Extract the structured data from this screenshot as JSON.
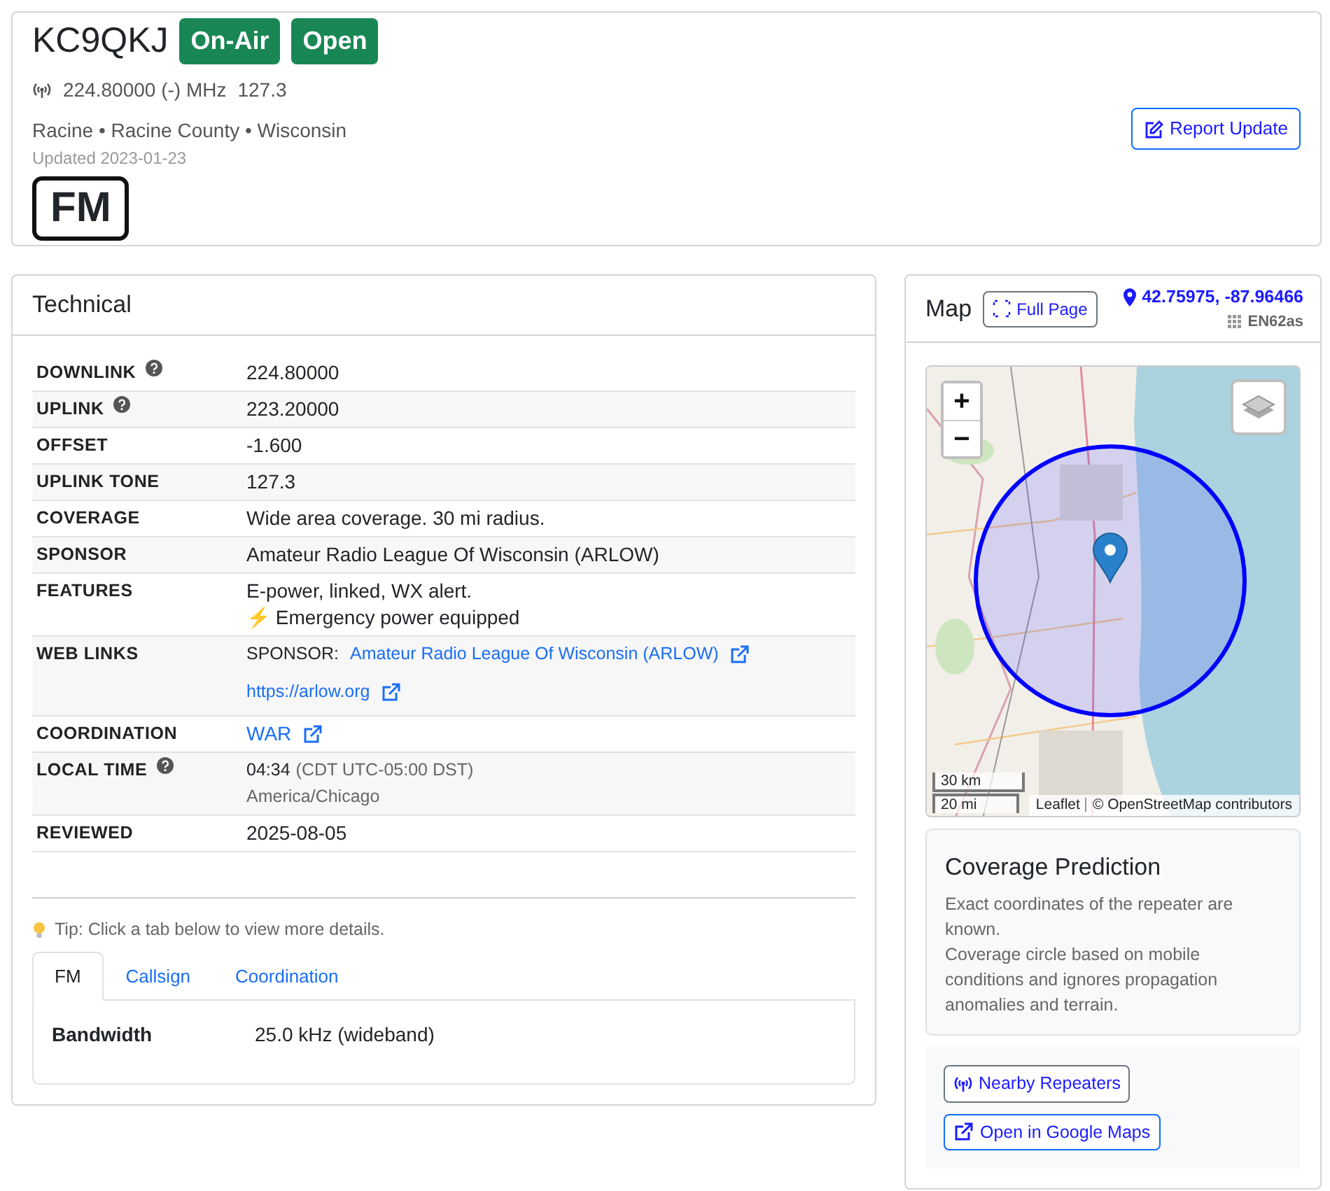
{
  "header": {
    "callsign": "KC9QKJ",
    "badges": [
      {
        "label": "On-Air"
      },
      {
        "label": "Open"
      }
    ],
    "frequency": "224.80000 (-) MHz",
    "tone": "127.3",
    "location": "Racine • Racine County • Wisconsin",
    "updated": "Updated 2023-01-23",
    "mode": "FM",
    "report_button": "Report Update"
  },
  "technical": {
    "title": "Technical",
    "rows": [
      {
        "label": "DOWNLINK",
        "help": true,
        "kind": "text",
        "value": "224.80000"
      },
      {
        "label": "UPLINK",
        "help": true,
        "kind": "text",
        "value": "223.20000"
      },
      {
        "label": "OFFSET",
        "help": false,
        "kind": "text",
        "value": "-1.600"
      },
      {
        "label": "UPLINK TONE",
        "help": false,
        "kind": "text",
        "value": "127.3"
      },
      {
        "label": "COVERAGE",
        "help": false,
        "kind": "text",
        "value": "Wide area coverage. 30 mi radius."
      },
      {
        "label": "SPONSOR",
        "help": false,
        "kind": "text",
        "value": "Amateur Radio League Of Wisconsin (ARLOW)"
      },
      {
        "label": "FEATURES",
        "help": false,
        "kind": "lines",
        "lines": [
          "E-power, linked, WX alert.",
          "⚡ Emergency power equipped"
        ]
      },
      {
        "label": "WEB LINKS",
        "help": false,
        "kind": "links",
        "links": [
          {
            "prefix": "SPONSOR:",
            "text": "Amateur Radio League Of Wisconsin (ARLOW)"
          },
          {
            "text": "https://arlow.org"
          }
        ]
      },
      {
        "label": "COORDINATION",
        "help": false,
        "kind": "link",
        "value": "WAR"
      },
      {
        "label": "LOCAL TIME",
        "help": true,
        "kind": "time",
        "time": "04:34",
        "zone": "(CDT UTC-05:00 DST)",
        "tz": "America/Chicago"
      },
      {
        "label": "REVIEWED",
        "help": false,
        "kind": "text",
        "value": "2025-08-05"
      }
    ],
    "tip": "Tip: Click a tab below to view more details.",
    "tabs": [
      {
        "label": "FM",
        "selected": true
      },
      {
        "label": "Callsign",
        "selected": false
      },
      {
        "label": "Coordination",
        "selected": false
      }
    ],
    "tab_rows": [
      {
        "label": "Bandwidth",
        "value": "25.0 kHz (wideband)"
      }
    ]
  },
  "map": {
    "title": "Map",
    "full_page_button": "Full Page",
    "coordinates": "42.75975, -87.96466",
    "grid": "EN62as",
    "zoom_in": "+",
    "zoom_out": "−",
    "scale": [
      "30 km",
      "20 mi"
    ],
    "attribution_link": "Leaflet",
    "attribution": "© OpenStreetMap contributors"
  },
  "coverage": {
    "title": "Coverage Prediction",
    "lines": [
      "Exact coordinates of the repeater are known.",
      "Coverage circle based on mobile conditions and ignores propagation anomalies and terrain."
    ]
  },
  "actions": [
    {
      "label": "Nearby Repeaters",
      "kind": "antenna"
    },
    {
      "label": "Open in Google Maps",
      "kind": "external"
    }
  ]
}
